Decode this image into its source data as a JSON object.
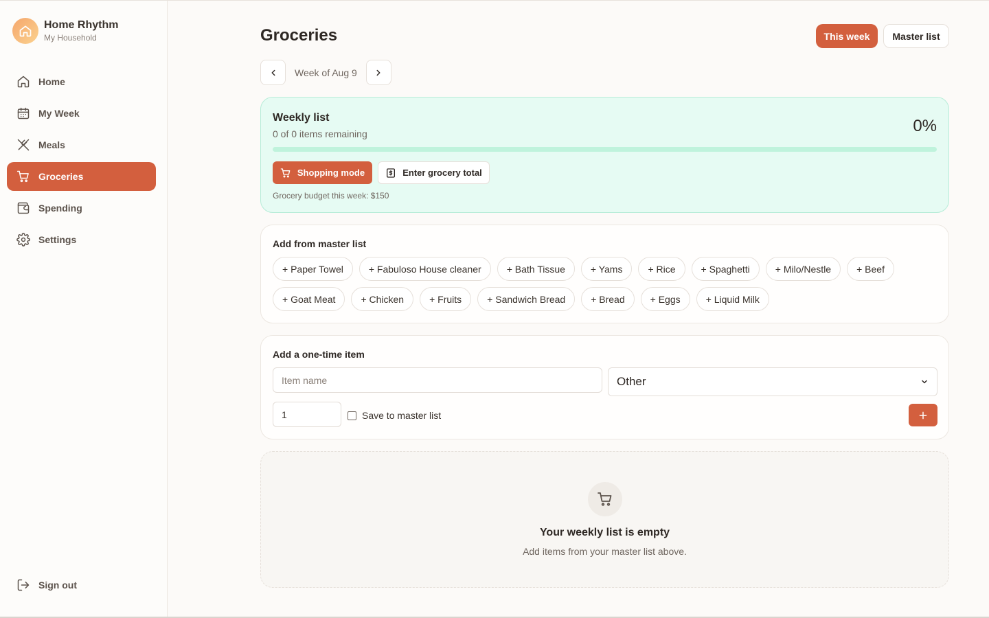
{
  "brand": {
    "name": "Home Rhythm",
    "household": "My Household"
  },
  "nav": {
    "items": [
      {
        "label": "Home",
        "icon": "home-icon"
      },
      {
        "label": "My Week",
        "icon": "calendar-icon"
      },
      {
        "label": "Meals",
        "icon": "utensils-icon"
      },
      {
        "label": "Groceries",
        "icon": "cart-icon",
        "active": true
      },
      {
        "label": "Spending",
        "icon": "wallet-icon"
      },
      {
        "label": "Settings",
        "icon": "gear-icon"
      }
    ],
    "signout": "Sign out"
  },
  "header": {
    "title": "Groceries",
    "this_week": "This week",
    "master_list": "Master list",
    "week_label": "Week of Aug 9"
  },
  "weekly": {
    "title": "Weekly list",
    "remaining": "0 of 0 items remaining",
    "percent": "0%",
    "progress": 0,
    "shopping_mode": "Shopping mode",
    "enter_total": "Enter grocery total",
    "budget": "Grocery budget this week: $150"
  },
  "master": {
    "heading": "Add from master list",
    "chips": [
      "+ Paper Towel",
      "+ Fabuloso House cleaner",
      "+ Bath Tissue",
      "+ Yams",
      "+ Rice",
      "+ Spaghetti",
      "+ Milo/Nestle",
      "+ Beef",
      "+ Goat Meat",
      "+ Chicken",
      "+ Fruits",
      "+ Sandwich Bread",
      "+ Bread",
      "+ Eggs",
      "+ Liquid Milk"
    ]
  },
  "one_time": {
    "heading": "Add a one-time item",
    "item_placeholder": "Item name",
    "category_selected": "Other",
    "quantity": "1",
    "save_label": "Save to master list"
  },
  "empty": {
    "title": "Your weekly list is empty",
    "subtitle": "Add items from your master list above."
  },
  "colors": {
    "accent": "#d35f3e",
    "progress_bg": "#bff3dc",
    "weekly_bg": "#e6fbf3"
  }
}
